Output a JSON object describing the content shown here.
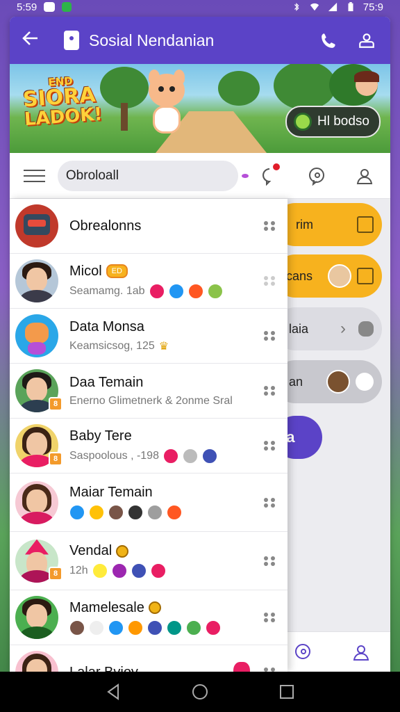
{
  "status_bar": {
    "time": "5:59",
    "right_time": "75:9"
  },
  "app_bar": {
    "title": "Sosial Nendanian"
  },
  "banner": {
    "logo_line1": "END",
    "logo_line2": "SIORA",
    "logo_line3": "LADOK!",
    "speech_text": "Hl bodso"
  },
  "search": {
    "value": "Obroloall"
  },
  "chats": [
    {
      "name": "Obrealonns",
      "sub": ""
    },
    {
      "name": "Micol",
      "tag": "ED",
      "sub": "Seamamg. 1ab"
    },
    {
      "name": "Data Monsa",
      "sub": "Keamsicsog, 125"
    },
    {
      "name": "Daa Temain",
      "sub": "Enerno Glimetnerk &  2onme Sral"
    },
    {
      "name": "Baby Tere",
      "sub": "Saspoolous , -198"
    },
    {
      "name": "Maiar Temain",
      "sub": ""
    },
    {
      "name": "Vendal",
      "sub": "12h"
    },
    {
      "name": "Mamelesale",
      "sub": ""
    },
    {
      "name": "Lalar Bvioy",
      "sub": ""
    }
  ],
  "side_pills": [
    {
      "label": "rim"
    },
    {
      "label": "cans"
    },
    {
      "label": "laia"
    },
    {
      "label": "an"
    },
    {
      "label": "sa"
    }
  ],
  "colors": {
    "primary": "#5b43c7",
    "accent_yellow": "#f7b21e",
    "notification": "#e11d2a"
  }
}
